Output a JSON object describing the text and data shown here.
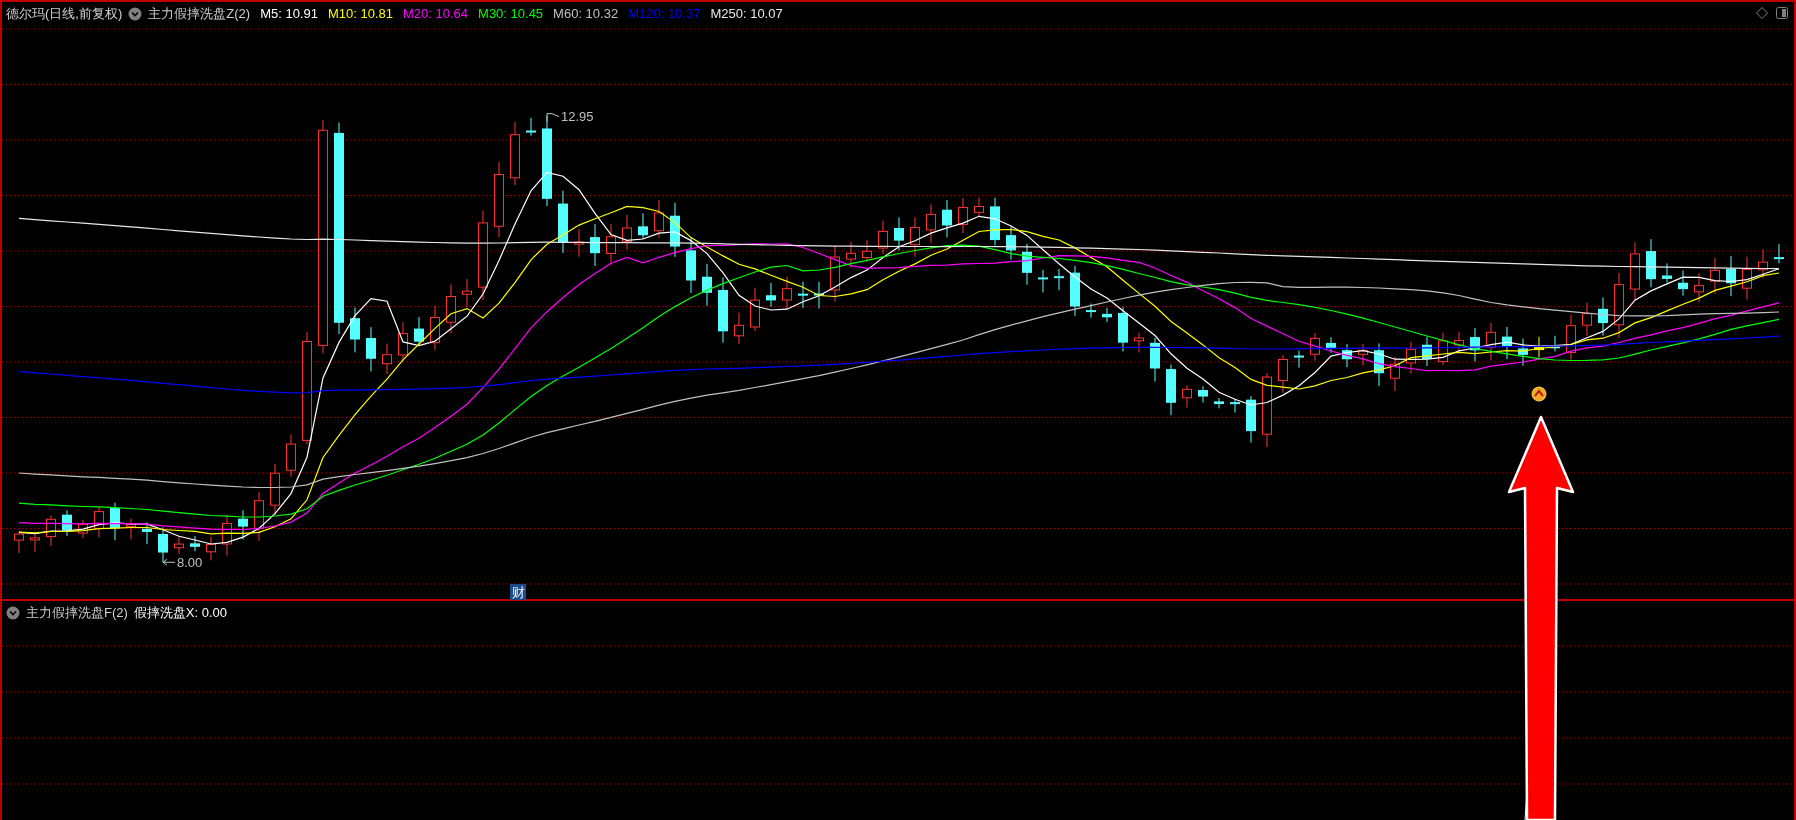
{
  "main_panel": {
    "stock_title": "德尔玛(日线,前复权)",
    "indicator_name": "主力假摔洗盘Z(2)",
    "moving_averages": [
      {
        "label": "M5: 10.91",
        "color": "#ffffff"
      },
      {
        "label": "M10: 10.81",
        "color": "#ffff00"
      },
      {
        "label": "M20: 10.64",
        "color": "#ff00ff"
      },
      {
        "label": "M30: 10.45",
        "color": "#00ff00"
      },
      {
        "label": "M60: 10.32",
        "color": "#c0c0c0"
      },
      {
        "label": "M120: 10.37",
        "color": "#0000ff"
      },
      {
        "label": "M250: 10.07",
        "color": "#e8e8e8"
      }
    ],
    "high_label": "12.95",
    "low_label": "8.00",
    "event_marker": "财"
  },
  "sub_panel": {
    "indicator_name": "主力假摔洗盘F(2)",
    "readout": "假摔洗盘X: 0.00"
  }
}
